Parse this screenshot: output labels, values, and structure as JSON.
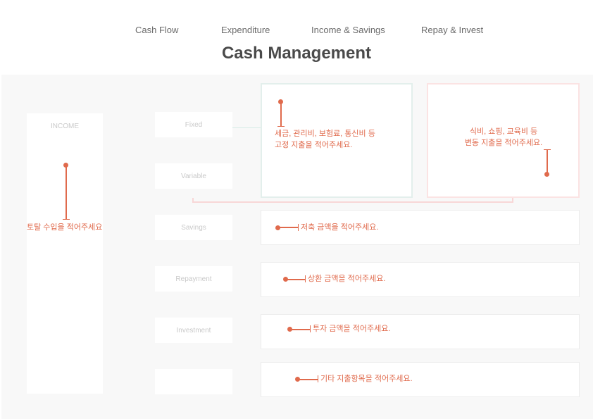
{
  "nav": {
    "items": [
      "Cash Flow",
      "Expenditure",
      "Income & Savings",
      "Repay & Invest"
    ]
  },
  "page_title": "Cash Management",
  "income": {
    "label": "INCOME",
    "hint": "토탈 수입을 적어주세요"
  },
  "categories": {
    "fixed": "Fixed",
    "variable": "Variable",
    "savings": "Savings",
    "repayment": "Repayment",
    "investment": "Investment",
    "other": ""
  },
  "hints": {
    "fixed_line1": "세금, 관리비, 보험료, 통신비 등",
    "fixed_line2": "고정 지출을 적어주세요.",
    "variable_line1": "식비, 쇼핑, 교육비 등",
    "variable_line2": "변동 지출을 적어주세요.",
    "savings": "저축 금액을 적어주세요.",
    "repayment": "상환 금액을 적어주세요.",
    "investment": "투자 금액을 적어주세요.",
    "other": "기타 지출항목을 적어주세요."
  },
  "colors": {
    "accent": "#e06a4c",
    "fixed_border": "#e3efec",
    "variable_border": "#fbe3e3",
    "placeholder_text": "#c9c9c9"
  }
}
